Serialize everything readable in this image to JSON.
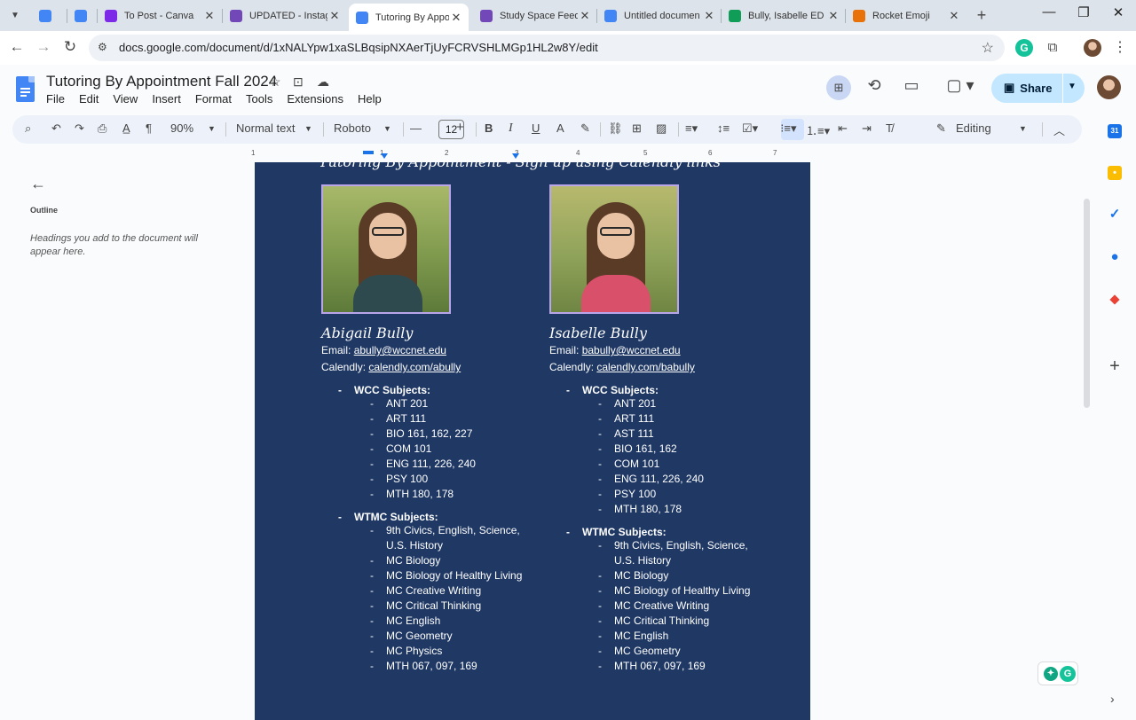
{
  "tabs": [
    {
      "title": "",
      "favicon": "calendar-icon",
      "color": "#4285f4"
    },
    {
      "title": "",
      "favicon": "docs-icon",
      "color": "#4285f4"
    },
    {
      "title": "To Post - Canva",
      "favicon": "canva-icon",
      "color": "#7d2ae8"
    },
    {
      "title": "UPDATED - Instag",
      "favicon": "forms-icon",
      "color": "#7248b9"
    },
    {
      "title": "Tutoring By Appo",
      "favicon": "docs-icon",
      "color": "#4285f4",
      "active": true
    },
    {
      "title": "Study Space Feed",
      "favicon": "forms-icon",
      "color": "#7248b9"
    },
    {
      "title": "Untitled documen",
      "favicon": "docs-icon",
      "color": "#4285f4"
    },
    {
      "title": "Bully, Isabelle ED",
      "favicon": "sheets-icon",
      "color": "#0f9d58"
    },
    {
      "title": "Rocket Emoji",
      "favicon": "emoji-icon",
      "color": "#e8710a"
    }
  ],
  "address": {
    "url": "docs.google.com/document/d/1xNALYpw1xaSLBqsipNXAerTjUyFCRVSHLMGp1HL2w8Y/edit"
  },
  "doc": {
    "title": "Tutoring By Appointment Fall 2024",
    "menus": [
      "File",
      "Edit",
      "View",
      "Insert",
      "Format",
      "Tools",
      "Extensions",
      "Help"
    ],
    "share_label": "Share"
  },
  "toolbar": {
    "zoom": "90%",
    "style": "Normal text",
    "font": "Roboto",
    "font_size": "12",
    "mode": "Editing"
  },
  "ruler": {
    "numbers": [
      "1",
      "1",
      "2",
      "3",
      "4",
      "5",
      "6",
      "7"
    ]
  },
  "outline": {
    "label": "Outline",
    "hint": "Headings you add to the document will appear here."
  },
  "page": {
    "heading": "Tutoring By Appointment - Sign up using Calendly links",
    "tutors": [
      {
        "name": "Abigail Bully",
        "email_label": "Email:",
        "email": "abully@wccnet.edu",
        "calendly_label": "Calendly:",
        "calendly": "calendly.com/abully",
        "wcc_heading": "WCC Subjects:",
        "wcc": [
          "ANT 201",
          "ART 111",
          "BIO 161, 162, 227",
          "COM 101",
          "ENG 111, 226, 240",
          "PSY 100",
          "MTH 180, 178"
        ],
        "wtmc_heading": "WTMC Subjects:",
        "wtmc": [
          "9th Civics, English, Science, U.S. History",
          "MC Biology",
          "MC Biology of Healthy Living",
          "MC Creative Writing",
          "MC Critical Thinking",
          "MC English",
          "MC Geometry",
          "MC Physics",
          "MTH 067, 097, 169"
        ],
        "shirt_color": "#2f4a4f"
      },
      {
        "name": "Isabelle Bully",
        "email_label": "Email:",
        "email": "babully@wccnet.edu",
        "calendly_label": "Calendly:",
        "calendly": "calendly.com/babully",
        "wcc_heading": "WCC Subjects:",
        "wcc": [
          "ANT 201",
          "ART 111",
          "AST 111",
          "BIO 161, 162",
          "COM 101",
          "ENG 111, 226, 240",
          "PSY 100",
          "MTH 180, 178"
        ],
        "wtmc_heading": "WTMC Subjects:",
        "wtmc": [
          "9th Civics, English, Science, U.S. History",
          "MC Biology",
          "MC Biology of Healthy Living",
          "MC Creative Writing",
          "MC Critical Thinking",
          "MC English",
          "MC Geometry",
          "MTH 067, 097, 169"
        ],
        "shirt_color": "#d9506b"
      }
    ]
  },
  "colors": {
    "page_bg": "#1f3864",
    "accent": "#1a73e8",
    "share_bg": "#c2e7ff"
  }
}
